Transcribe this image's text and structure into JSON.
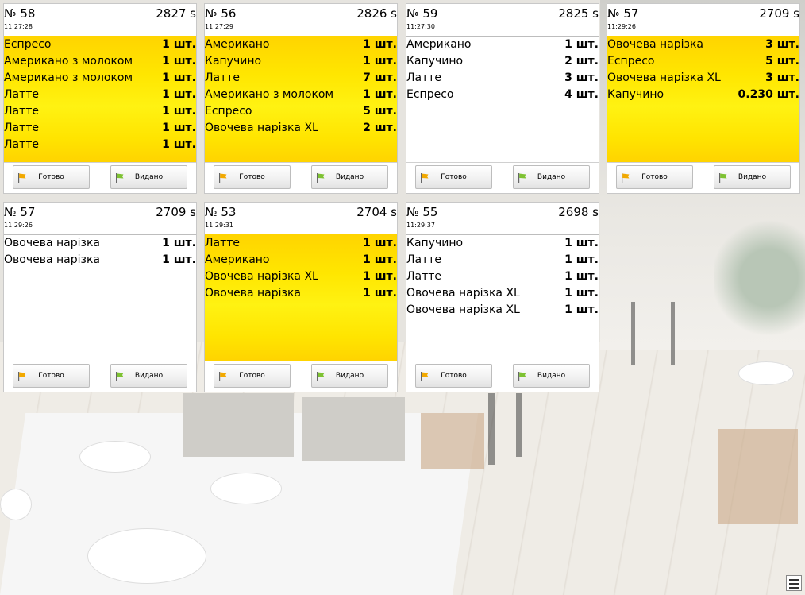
{
  "colors": {
    "highlight": "#ffe600",
    "card_bg": "#ffffff",
    "flag_ready": "#f2a900",
    "flag_issued": "#7ec232"
  },
  "buttons": {
    "ready_label": "Готово",
    "issued_label": "Видано"
  },
  "orders": [
    {
      "number": "№ 58",
      "elapsed": "2827 s",
      "time": "11:27:28",
      "highlight": true,
      "items": [
        {
          "name": "Еспресо",
          "qty": "1 шт."
        },
        {
          "name": "Американо з молоком",
          "qty": "1 шт."
        },
        {
          "name": "Американо з молоком",
          "qty": "1 шт."
        },
        {
          "name": "Латте",
          "qty": "1 шт."
        },
        {
          "name": "Латте",
          "qty": "1 шт."
        },
        {
          "name": "Латте",
          "qty": "1 шт."
        },
        {
          "name": "Латте",
          "qty": "1 шт."
        }
      ]
    },
    {
      "number": "№ 56",
      "elapsed": "2826 s",
      "time": "11:27:29",
      "highlight": true,
      "items": [
        {
          "name": "Американо",
          "qty": "1 шт."
        },
        {
          "name": "Капучино",
          "qty": "1 шт."
        },
        {
          "name": "Латте",
          "qty": "7 шт."
        },
        {
          "name": "Американо з молоком",
          "qty": "1 шт."
        },
        {
          "name": "Еспресо",
          "qty": "5 шт."
        },
        {
          "name": "Овочева нарізка XL",
          "qty": "2 шт."
        }
      ]
    },
    {
      "number": "№ 59",
      "elapsed": "2825 s",
      "time": "11:27:30",
      "highlight": false,
      "items": [
        {
          "name": "Американо",
          "qty": "1 шт."
        },
        {
          "name": "Капучино",
          "qty": "2 шт."
        },
        {
          "name": "Латте",
          "qty": "3 шт."
        },
        {
          "name": "Еспресо",
          "qty": "4 шт."
        }
      ]
    },
    {
      "number": "№ 57",
      "elapsed": "2709 s",
      "time": "11:29:26",
      "highlight": true,
      "items": [
        {
          "name": "Овочева нарізка",
          "qty": "3 шт."
        },
        {
          "name": "Еспресо",
          "qty": "5 шт."
        },
        {
          "name": "Овочева нарізка XL",
          "qty": "3 шт."
        },
        {
          "name": "Капучино",
          "qty": "0.230 шт."
        }
      ]
    },
    {
      "number": "№ 57",
      "elapsed": "2709 s",
      "time": "11:29:26",
      "highlight": false,
      "items": [
        {
          "name": "Овочева нарізка",
          "qty": "1 шт."
        },
        {
          "name": "Овочева нарізка",
          "qty": "1 шт."
        }
      ]
    },
    {
      "number": "№ 53",
      "elapsed": "2704 s",
      "time": "11:29:31",
      "highlight": true,
      "items": [
        {
          "name": "Латте",
          "qty": "1 шт."
        },
        {
          "name": "Американо",
          "qty": "1 шт."
        },
        {
          "name": "Овочева нарізка XL",
          "qty": "1 шт."
        },
        {
          "name": "Овочева нарізка",
          "qty": "1 шт."
        }
      ]
    },
    {
      "number": "№ 55",
      "elapsed": "2698 s",
      "time": "11:29:37",
      "highlight": false,
      "items": [
        {
          "name": "Капучино",
          "qty": "1 шт."
        },
        {
          "name": "Латте",
          "qty": "1 шт."
        },
        {
          "name": "Латте",
          "qty": "1 шт."
        },
        {
          "name": "Овочева нарізка XL",
          "qty": "1 шт."
        },
        {
          "name": "Овочева нарізка XL",
          "qty": "1 шт."
        }
      ]
    }
  ],
  "menu_icon": "menu-icon"
}
